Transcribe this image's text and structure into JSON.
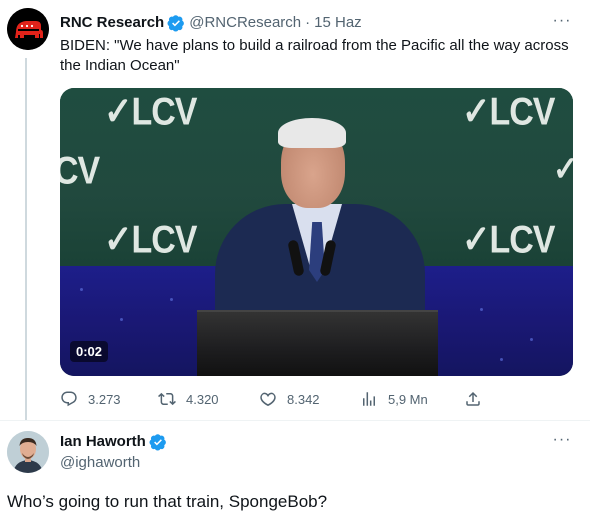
{
  "tweet1": {
    "author_name": "RNC Research",
    "handle": "@RNCResearch",
    "separator": "·",
    "date": "15 Haz",
    "text": "BIDEN: \"We have plans to build a railroad from the Pacific all the way across the Indian Ocean\"",
    "media": {
      "banner_text": "✓LCV",
      "banner_text_partial": "CV",
      "timestamp": "0:02"
    },
    "actions": {
      "replies": "3.273",
      "retweets": "4.320",
      "likes": "8.342",
      "views": "5,9 Mn"
    }
  },
  "tweet2": {
    "author_name": "Ian Haworth",
    "handle": "@ighaworth",
    "text": "Who’s going to run that train, SpongeBob?"
  },
  "icons": {
    "more": "more-horizontal-icon",
    "verified": "verified-badge-icon",
    "reply": "reply-icon",
    "retweet": "retweet-icon",
    "like": "heart-icon",
    "views": "views-chart-icon",
    "share": "share-icon"
  },
  "colors": {
    "verified_blue": "#1d9bf0",
    "secondary_text": "#536471",
    "primary_text": "#0f1419",
    "thread_line": "#cfd9de",
    "rnc_red": "#e2231a"
  }
}
